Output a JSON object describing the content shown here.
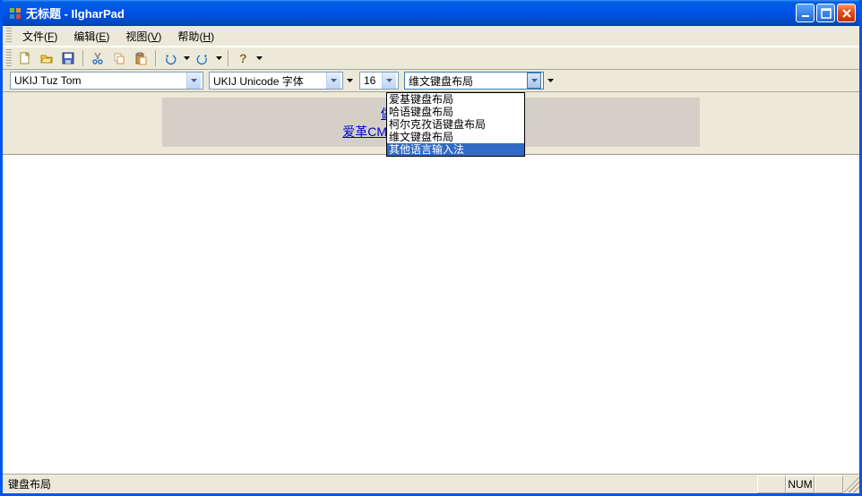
{
  "title": "无标题 - IlgharPad",
  "menu": {
    "file": {
      "label": "文件",
      "accel": "F"
    },
    "edit": {
      "label": "编辑",
      "accel": "E"
    },
    "view": {
      "label": "视图",
      "accel": "V"
    },
    "help": {
      "label": "帮助",
      "accel": "H"
    }
  },
  "toolbar": {
    "new": "new-icon",
    "open": "open-icon",
    "save": "save-icon",
    "cut": "cut-icon",
    "copy": "copy-icon",
    "paste": "paste-icon",
    "undo": "undo-icon",
    "redo": "redo-icon",
    "help": "help-icon"
  },
  "combos": {
    "font": "UKIJ Tuz Tom",
    "encoding": "UKIJ Unicode 字体",
    "size": "16",
    "keyboard": "维文键盘布局"
  },
  "keyboard_options": [
    "爱基键盘布局",
    "哈语键盘布局",
    "柯尔克孜语键盘布局",
    "维文键盘布局",
    "其他语言输入法"
  ],
  "keyboard_selected_index": 4,
  "banner": {
    "line1": "做网站，选爱革！",
    "line2": "爱革CMS - 最好的asp.net免费C"
  },
  "statusbar": {
    "main": "键盘布局",
    "num": "NUM"
  }
}
